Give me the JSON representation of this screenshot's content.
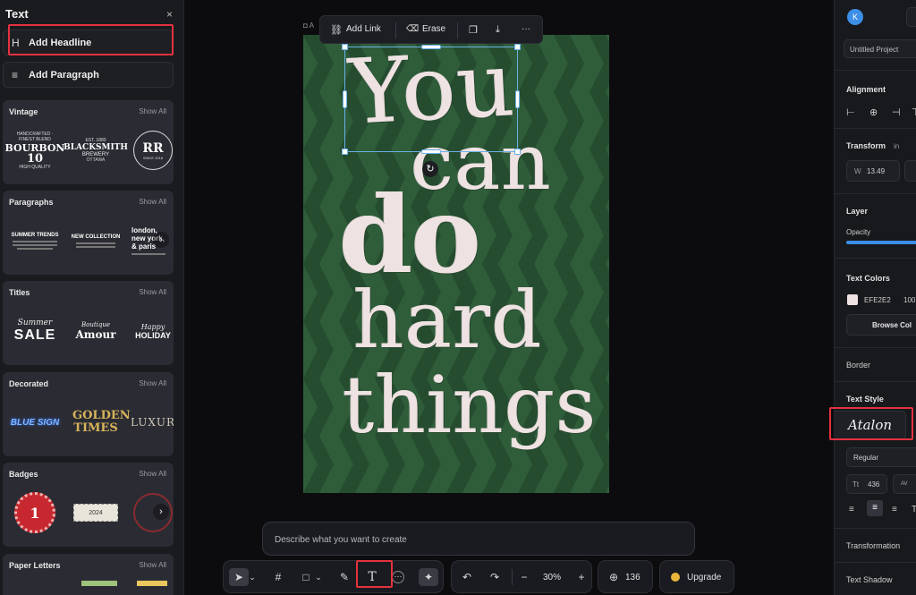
{
  "left_panel": {
    "title": "Text",
    "close_icon": "×",
    "add_headline": "Add Headline",
    "add_paragraph": "Add Paragraph",
    "headline_icon": "H",
    "paragraph_icon": "≡",
    "categories": [
      {
        "title": "Vintage",
        "show_all": "Show All",
        "items": [
          {
            "top": "HANDCRAFTED · FINEST BLEND",
            "main": "BOURBON",
            "sub": "10",
            "foot": "HIGH QUALITY"
          },
          {
            "top": "EST. 1880",
            "main": "BLACKSMITH",
            "sub": "BREWERY",
            "foot": "OTTAWA"
          },
          {
            "top": "",
            "main": "RR",
            "sub": "SINCE 2018",
            "foot": ""
          }
        ]
      },
      {
        "title": "Paragraphs",
        "show_all": "Show All",
        "items": [
          {
            "main": "SUMMER TRENDS"
          },
          {
            "main": "NEW COLLECTION"
          },
          {
            "main": "london, new york, & paris"
          }
        ]
      },
      {
        "title": "Titles",
        "show_all": "Show All",
        "items": [
          {
            "top": "Summer",
            "main": "SALE"
          },
          {
            "top": "Boutique",
            "main": "Amour"
          },
          {
            "top": "Happy",
            "main": "HOLIDAY"
          }
        ]
      },
      {
        "title": "Decorated",
        "show_all": "Show All",
        "items": [
          {
            "main": "BLUE SIGN"
          },
          {
            "main": "GOLDEN TIMES"
          },
          {
            "main": "LUXUR"
          }
        ]
      },
      {
        "title": "Badges",
        "show_all": "Show All",
        "items": [
          {
            "main": "1"
          },
          {
            "main": "2024"
          },
          {
            "main": ""
          }
        ]
      },
      {
        "title": "Paper Letters",
        "show_all": "Show All",
        "items": []
      }
    ]
  },
  "canvas": {
    "artboard_label": "A",
    "poster_words": [
      "You",
      "can",
      "do",
      "hard",
      "things"
    ],
    "poster_bg": "#2f5d3a",
    "stripe_color": "#254c2f",
    "text_color": "#EFE2E2",
    "rotate_icon": "↻"
  },
  "floating_toolbar": {
    "add_link": "Add Link",
    "erase": "Erase",
    "link_icon": "🔗",
    "erase_icon": "⌫",
    "duplicate_icon": "❐",
    "download_icon": "⤓",
    "more_icon": "···"
  },
  "prompt": {
    "placeholder": "Describe what you want to create"
  },
  "bottom_toolbar": {
    "select_icon": "➤",
    "chevron_icon": "⌄",
    "frame_icon": "#",
    "shape_icon": "□",
    "pen_icon": "✎",
    "text_icon": "T",
    "comment_icon": "⋯",
    "ai_icon": "✦",
    "undo_icon": "↶",
    "redo_icon": "↷",
    "zoom_out": "−",
    "zoom": "30%",
    "zoom_in": "+",
    "plus_icon": "⊕",
    "credits": "136",
    "upgrade": "Upgrade"
  },
  "right_panel": {
    "avatar": "K",
    "project_name": "Untitled Project",
    "alignment": "Alignment",
    "transform": "Transform",
    "transform_unit": "in",
    "w_label": "W",
    "w_value": "13.49",
    "layer": "Layer",
    "opacity": "Opacity",
    "opacity_value": 1.0,
    "text_colors": "Text Colors",
    "color_hex": "EFE2E2",
    "color_opacity": "100",
    "browse_colors": "Browse Col",
    "border": "Border",
    "text_style": "Text Style",
    "font_name": "Atalon",
    "font_weight": "Regular",
    "font_size": "436",
    "font_size_icon": "Tt",
    "spacing_icon": "AV",
    "transformation": "Transformation",
    "text_shadow": "Text Shadow"
  }
}
